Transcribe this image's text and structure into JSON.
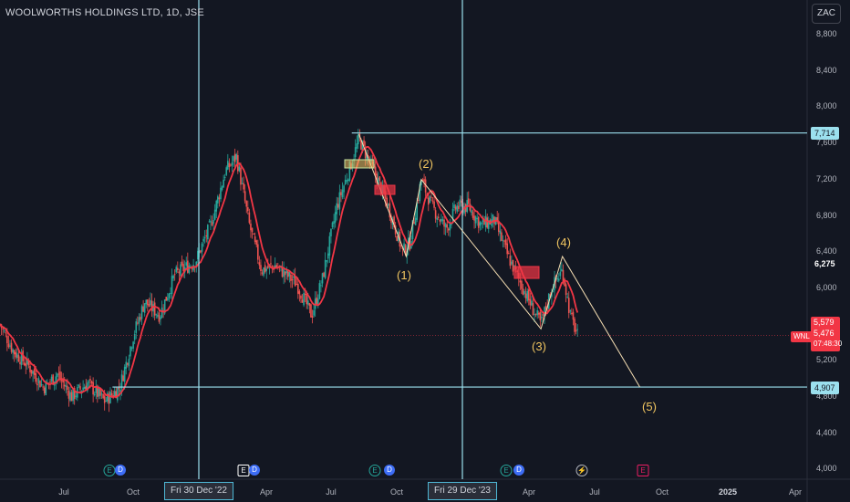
{
  "header": {
    "title": "WOOLWORTHS HOLDINGS LTD, 1D, JSE",
    "currency_button": "ZAC"
  },
  "colors": {
    "background": "#131722",
    "up": "#26a69a",
    "down": "#ef5350",
    "ma": "#f23645",
    "cyan": "#9be0ee",
    "wave": "#f0c560"
  },
  "price_axis": {
    "ticks": [
      "8,800",
      "8,400",
      "8,000",
      "7,600",
      "7,200",
      "6,800",
      "6,400",
      "6,000",
      "5,200",
      "4,800",
      "4,400",
      "4,000"
    ]
  },
  "time_axis": {
    "ticks": [
      "Jul",
      "Oct",
      "Apr",
      "Jul",
      "Oct",
      "Apr",
      "Jul",
      "Oct",
      "2025",
      "Apr"
    ],
    "cursor_flags": [
      "Fri 30 Dec '22",
      "Fri 29 Dec '23"
    ]
  },
  "price_labels": {
    "line_top": "7,714",
    "level_6275": "6,275",
    "ma_value": "5,579",
    "last_price": "5,476",
    "countdown": "07:48:30",
    "line_bottom": "4,907",
    "symbol": "WNL"
  },
  "wave_labels": [
    "(1)",
    "(2)",
    "(3)",
    "(4)",
    "(5)"
  ],
  "events": {
    "earnings": "E",
    "dividend": "D",
    "split": "⚡"
  },
  "chart_data": {
    "type": "candlestick",
    "title": "WOOLWORTHS HOLDINGS LTD, 1D, JSE",
    "ylim": [
      3900,
      9100
    ],
    "x_range": [
      "2022-04",
      "2025-04"
    ],
    "horizontal_levels": [
      7714,
      4907
    ],
    "last_price": 5476,
    "moving_average_last": 5579,
    "path": [
      [
        "2022-04-01",
        5600
      ],
      [
        "2022-04-20",
        5300
      ],
      [
        "2022-05-10",
        5150
      ],
      [
        "2022-06-01",
        4900
      ],
      [
        "2022-06-20",
        5050
      ],
      [
        "2022-07-10",
        4800
      ],
      [
        "2022-08-01",
        4950
      ],
      [
        "2022-08-25",
        4750
      ],
      [
        "2022-09-15",
        4900
      ],
      [
        "2022-10-05",
        5500
      ],
      [
        "2022-10-20",
        5850
      ],
      [
        "2022-11-10",
        5700
      ],
      [
        "2022-12-01",
        6150
      ],
      [
        "2022-12-30",
        6300
      ],
      [
        "2023-01-20",
        6700
      ],
      [
        "2023-02-10",
        7300
      ],
      [
        "2023-02-25",
        7450
      ],
      [
        "2023-03-15",
        6700
      ],
      [
        "2023-04-01",
        6200
      ],
      [
        "2023-04-20",
        6250
      ],
      [
        "2023-05-20",
        6050
      ],
      [
        "2023-06-10",
        5700
      ],
      [
        "2023-06-25",
        6100
      ],
      [
        "2023-07-15",
        6900
      ],
      [
        "2023-08-01",
        7300
      ],
      [
        "2023-08-15",
        7650
      ],
      [
        "2023-09-10",
        7200
      ],
      [
        "2023-09-25",
        6900
      ],
      [
        "2023-10-15",
        6400
      ],
      [
        "2023-10-25",
        6500
      ],
      [
        "2023-11-10",
        7200
      ],
      [
        "2023-11-25",
        6900
      ],
      [
        "2023-12-15",
        6650
      ],
      [
        "2023-12-29",
        6900
      ],
      [
        "2024-01-15",
        6900
      ],
      [
        "2024-02-01",
        6700
      ],
      [
        "2024-02-20",
        6750
      ],
      [
        "2024-03-10",
        6350
      ],
      [
        "2024-03-25",
        6100
      ],
      [
        "2024-04-15",
        5750
      ],
      [
        "2024-04-25",
        5600
      ],
      [
        "2024-05-10",
        6000
      ],
      [
        "2024-05-25",
        6200
      ],
      [
        "2024-06-05",
        5700
      ],
      [
        "2024-06-15",
        5476
      ]
    ],
    "elliott_waves": [
      {
        "label": "(1)",
        "date": "2023-10-20",
        "price": 6350
      },
      {
        "label": "(2)",
        "date": "2023-11-10",
        "price": 7200
      },
      {
        "label": "(3)",
        "date": "2024-04-25",
        "price": 5550
      },
      {
        "label": "(4)",
        "date": "2024-05-25",
        "price": 6350
      },
      {
        "label": "(5)",
        "date": "2024-09-10",
        "price": 4907
      }
    ]
  }
}
